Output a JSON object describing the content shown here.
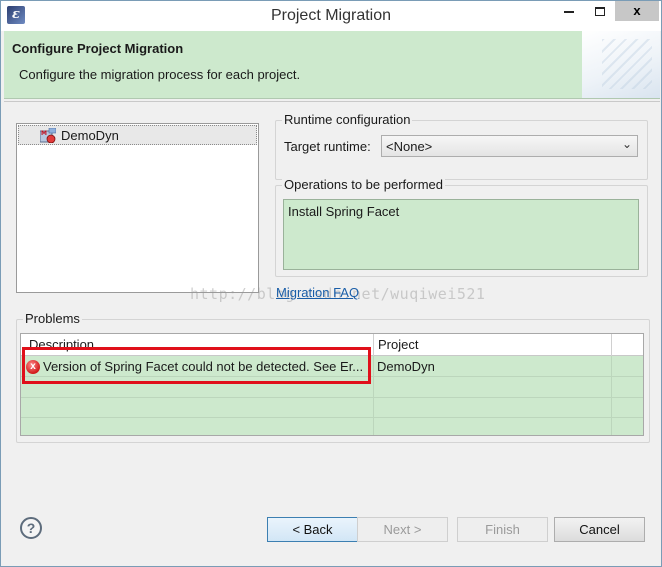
{
  "window": {
    "title": "Project Migration",
    "icon": "eclipse-app-icon",
    "controls": {
      "minimize": "minimize-icon",
      "maximize": "maximize-icon",
      "close": "x"
    }
  },
  "banner": {
    "title": "Configure Project Migration",
    "description": "Configure the migration process for each project."
  },
  "projects": [
    {
      "label": "DemoDyn",
      "icon": "maven-web-project-icon",
      "selected": true
    }
  ],
  "runtime": {
    "group_title": "Runtime configuration",
    "target_label": "Target runtime:",
    "target_value": "<None>"
  },
  "operations": {
    "group_title": "Operations to be performed",
    "items": [
      "Install Spring Facet"
    ]
  },
  "links": {
    "faq": "Migration FAQ"
  },
  "watermark": "http://blog.csdn.net/wuqiwei521",
  "problems": {
    "group_title": "Problems",
    "columns": [
      "Description",
      "Project"
    ],
    "rows": [
      {
        "description": "Version of Spring Facet could not be detected. See Er...",
        "project": "DemoDyn",
        "severity": "error"
      }
    ]
  },
  "footer": {
    "help_icon": "?",
    "back": "< Back",
    "next": "Next >",
    "finish": "Finish",
    "cancel": "Cancel"
  },
  "colors": {
    "banner_bg": "#cde9cd",
    "highlight_border": "#e0101a",
    "link": "#1a5ea8"
  }
}
